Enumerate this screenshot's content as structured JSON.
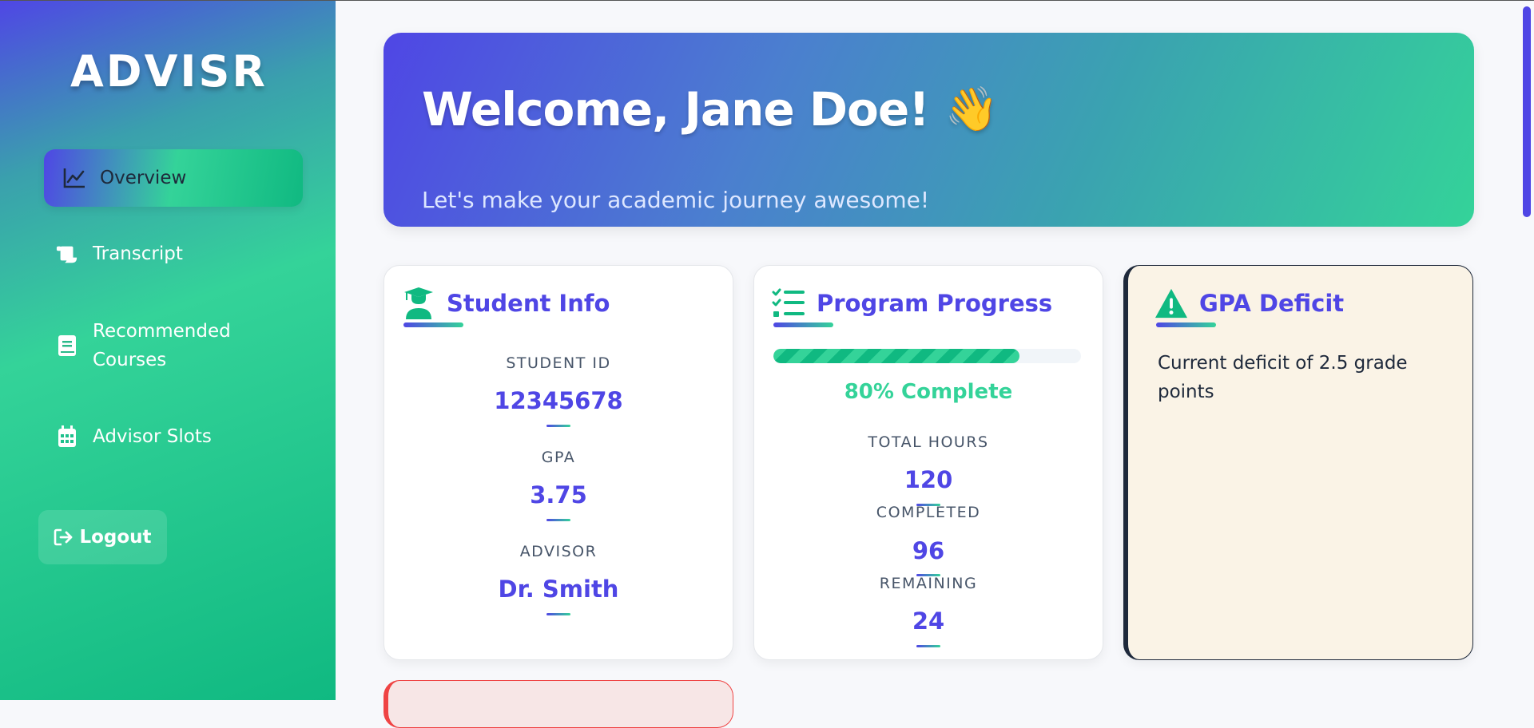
{
  "app": {
    "logo": "ADVISR"
  },
  "sidebar": {
    "items": [
      {
        "label": "Overview",
        "icon": "chart-line-icon",
        "active": true
      },
      {
        "label": "Transcript",
        "icon": "scroll-icon"
      },
      {
        "label": "Recommended Courses",
        "icon": "book-icon"
      },
      {
        "label": "Advisor Slots",
        "icon": "calendar-icon"
      }
    ],
    "logout_label": "Logout"
  },
  "banner": {
    "title": "Welcome, Jane Doe!",
    "emoji": "👋",
    "subtitle": "Let's make your academic journey awesome!"
  },
  "student_info": {
    "title": "Student Info",
    "icon": "graduate-icon",
    "id_label": "STUDENT ID",
    "id_value": "12345678",
    "gpa_label": "GPA",
    "gpa_value": "3.75",
    "advisor_label": "ADVISOR",
    "advisor_value": "Dr. Smith"
  },
  "program_progress": {
    "title": "Program Progress",
    "icon": "tasks-icon",
    "progress_fraction": 0.8,
    "progress_text": "80% Complete",
    "total_label": "TOTAL HOURS",
    "total_value": "120",
    "completed_label": "COMPLETED",
    "completed_value": "96",
    "remaining_label": "REMAINING",
    "remaining_value": "24"
  },
  "gpa_deficit": {
    "title": "GPA Deficit",
    "icon": "warning-icon",
    "text": "Current deficit of 2.5 grade points"
  },
  "colors": {
    "primary": "#4f46e5",
    "accent": "#34d399",
    "accent_dark": "#10b981",
    "deficit_bg": "#faf3e6",
    "alert": "#ef4444"
  }
}
